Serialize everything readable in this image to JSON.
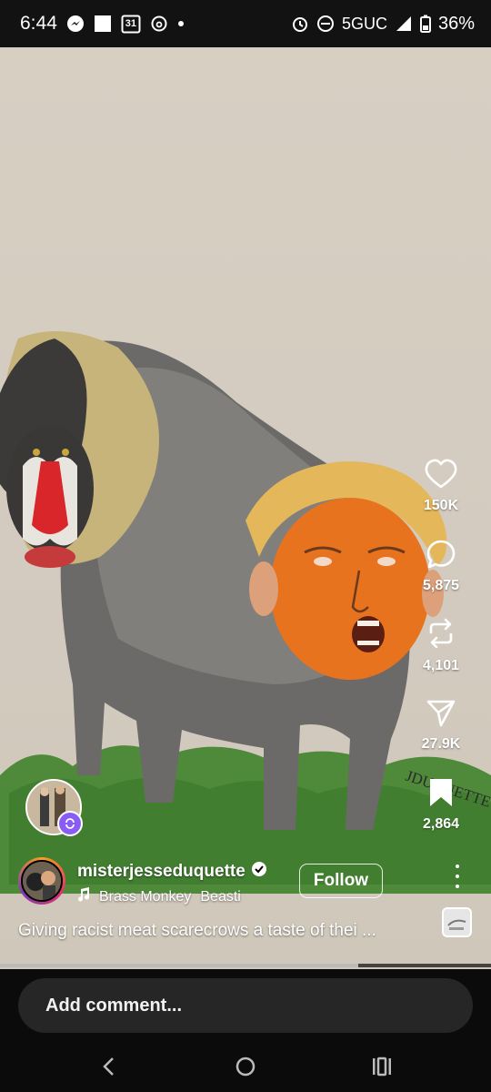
{
  "status_bar": {
    "time": "6:44",
    "calendar_day": "31",
    "network": "5GUC",
    "battery": "36%"
  },
  "actions": {
    "likes": "150K",
    "comments": "5,875",
    "reposts": "4,101",
    "shares": "27.9K",
    "saves": "2,864"
  },
  "artwork": {
    "signature": "JDUQUETTE"
  },
  "post": {
    "username": "misterjesseduquette",
    "follow_label": "Follow",
    "song": "Brass Monkey",
    "artist": "Beasti",
    "caption": "Giving racist meat scarecrows a taste of thei ..."
  },
  "playback": {
    "progress": 0.73
  },
  "comment_box": {
    "placeholder": "Add comment..."
  },
  "colors": {
    "accent_remix": "#8a5cf6",
    "background": "#000000",
    "input_bg": "#262626"
  },
  "icons": [
    "messenger-icon",
    "notification-square-icon",
    "calendar-icon",
    "threads-icon",
    "alarm-icon",
    "dnd-icon",
    "signal-icon",
    "battery-icon",
    "heart-icon",
    "comment-icon",
    "repost-icon",
    "share-icon",
    "bookmark-icon",
    "music-note-icon",
    "verified-icon",
    "back-icon",
    "home-icon",
    "recents-icon"
  ]
}
